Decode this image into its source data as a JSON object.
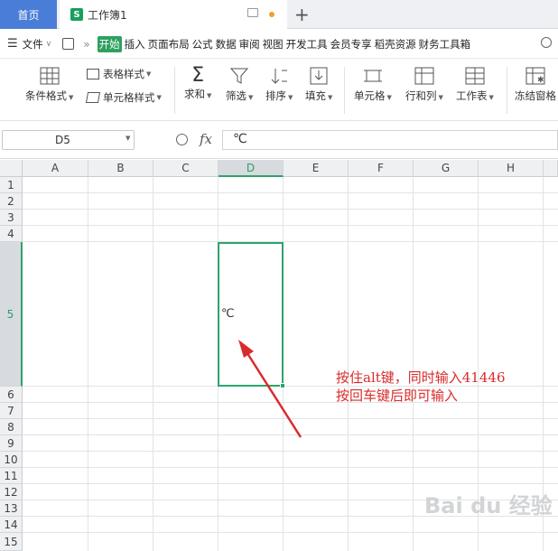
{
  "tabs": {
    "home": "首页",
    "book_icon": "S",
    "book": "工作簿1"
  },
  "menu": {
    "file": "文件",
    "expand": "»",
    "items": [
      "开始",
      "插入",
      "页面布局",
      "公式",
      "数据",
      "审阅",
      "视图",
      "开发工具",
      "会员专享",
      "稻壳资源",
      "财务工具箱"
    ]
  },
  "ribbon": {
    "cond_format": "条件格式",
    "table_style": "表格样式",
    "cell_style": "单元格样式",
    "sum": "求和",
    "filter": "筛选",
    "sort": "排序",
    "fill": "填充",
    "cell": "单元格",
    "rowcol": "行和列",
    "sheet": "工作表",
    "freeze": "冻结窗格"
  },
  "formula_bar": {
    "name_box": "D5",
    "fx": "fx",
    "content": "℃"
  },
  "columns": [
    "A",
    "B",
    "C",
    "D",
    "E",
    "F",
    "G",
    "H"
  ],
  "rows": [
    "1",
    "2",
    "3",
    "4",
    "5",
    "6",
    "7",
    "8",
    "9",
    "10",
    "11",
    "12",
    "13",
    "14",
    "15"
  ],
  "cells": {
    "D5": "℃"
  },
  "annotation": {
    "line1": "按住alt键，同时输入41446",
    "line2": "按回车键后即可输入"
  },
  "watermark": "Bai du 经验",
  "colors": {
    "accent_green": "#2ea46b",
    "home_tab": "#4a7dd8",
    "note_red": "#d92b2b"
  }
}
